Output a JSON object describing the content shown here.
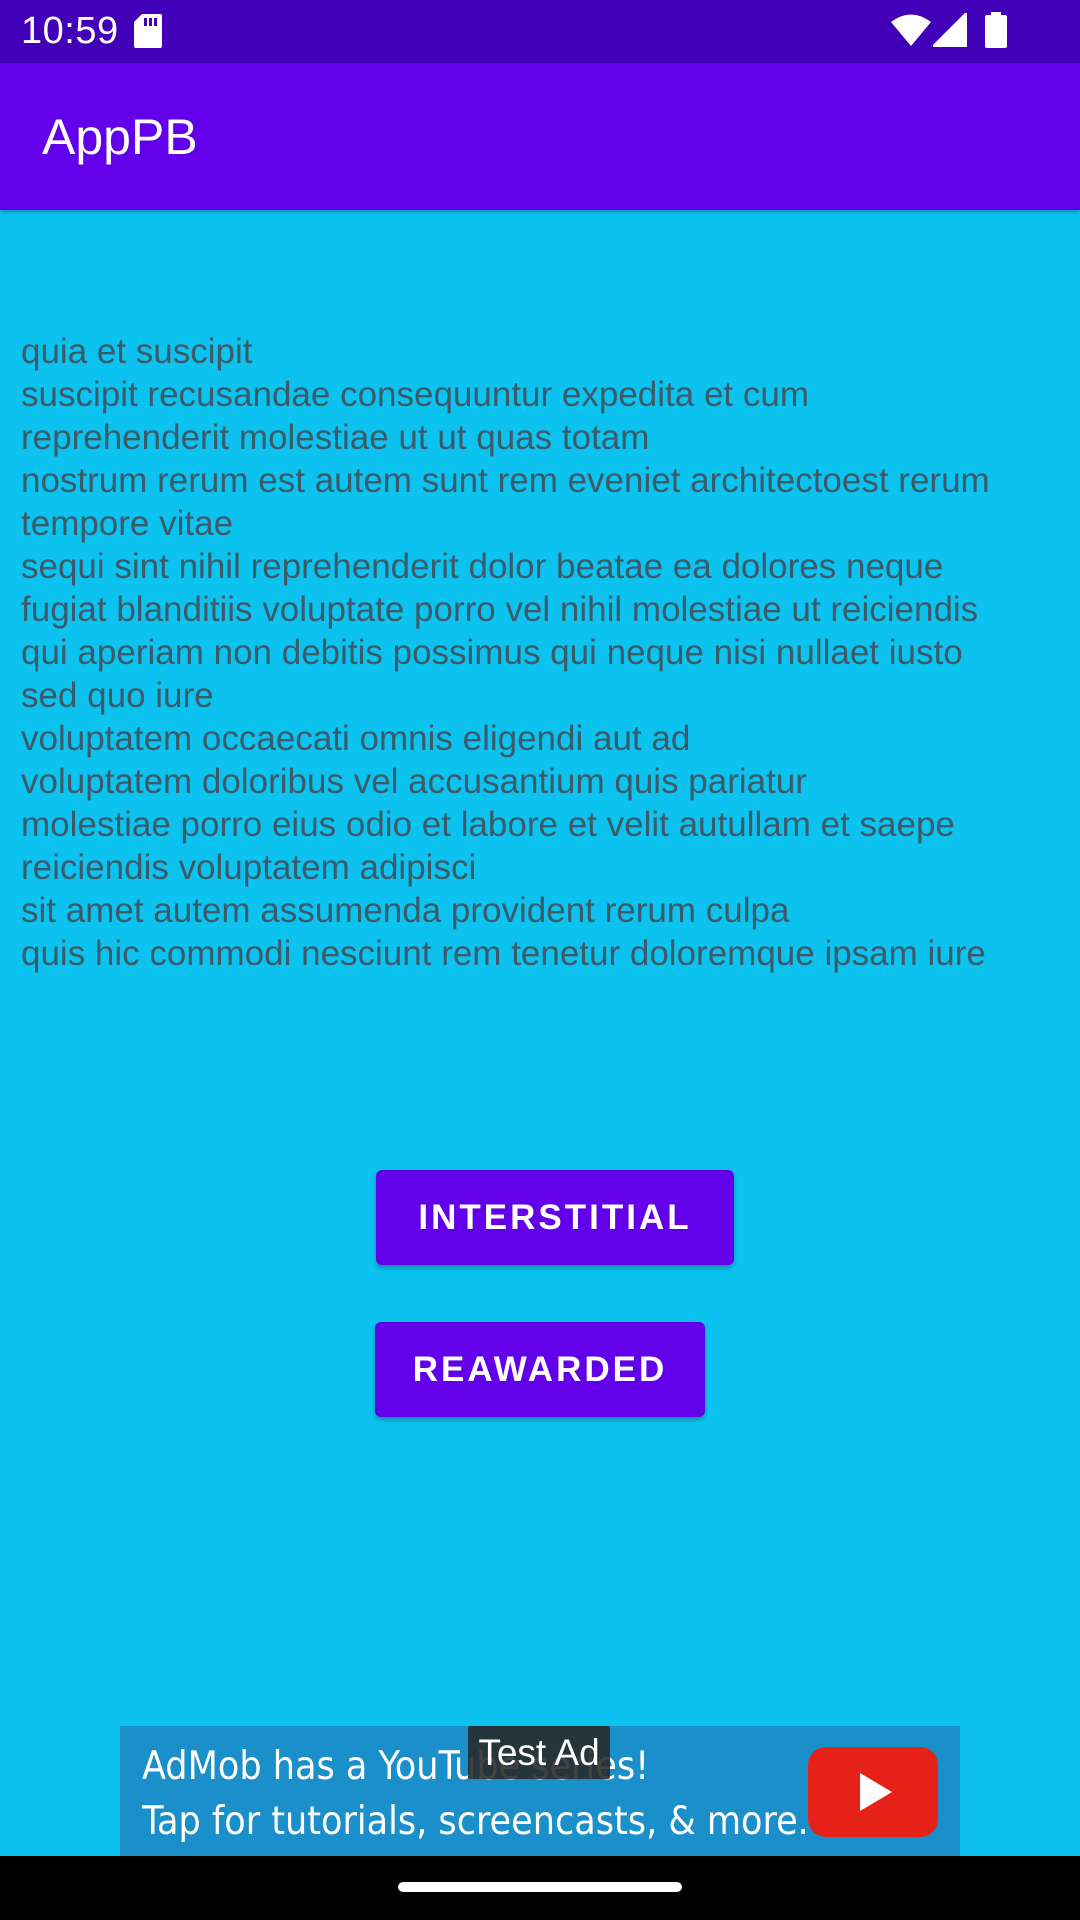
{
  "status_bar": {
    "time": "10:59",
    "icons": [
      "sd-card-icon",
      "wifi-icon",
      "signal-icon",
      "battery-icon"
    ]
  },
  "app_bar": {
    "title": "AppPB"
  },
  "content": {
    "text": "quia et suscipit\nsuscipit recusandae consequuntur expedita et cum\nreprehenderit molestiae ut ut quas totam\nnostrum rerum est autem sunt rem eveniet architectoest rerum\ntempore vitae\nsequi sint nihil reprehenderit dolor beatae ea dolores neque\nfugiat blanditiis voluptate porro vel nihil molestiae ut reiciendis\nqui aperiam non debitis possimus qui neque nisi nullaet iusto\nsed quo iure\nvoluptatem occaecati omnis eligendi aut ad\nvoluptatem doloribus vel accusantium quis pariatur\nmolestiae porro eius odio et labore et velit autullam et saepe\nreiciendis voluptatem adipisci\nsit amet autem assumenda provident rerum culpa\nquis hic commodi nesciunt rem tenetur doloremque ipsam iure"
  },
  "buttons": {
    "interstitial": "INTERSTITIAL",
    "rewarded": "REAWARDED"
  },
  "ad": {
    "label": "Test Ad",
    "line1": "AdMob has a YouTube series!",
    "line2": "Tap for tutorials, screencasts, & more.",
    "icon": "youtube-play-icon"
  },
  "colors": {
    "status_bar": "#4200b8",
    "app_bar": "#6200ea",
    "background": "#0cc3f0",
    "button": "#6200ea",
    "ad_background": "#1a8fca",
    "youtube_red": "#e62117"
  }
}
